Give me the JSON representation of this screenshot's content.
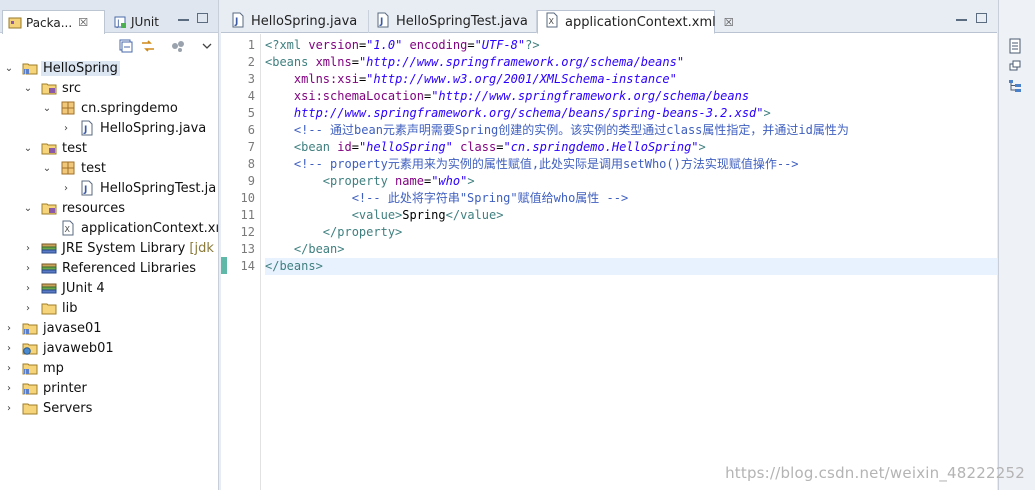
{
  "left_panel": {
    "tabs": [
      {
        "label": "Packa...",
        "close": "☒"
      },
      {
        "label": "JUnit",
        "close": "☒"
      }
    ],
    "tree": [
      {
        "label": "HelloSpring",
        "level": 0,
        "arrow": "⌄",
        "icon": "project-icon",
        "selected": true
      },
      {
        "label": "src",
        "level": 1,
        "arrow": "⌄",
        "icon": "source-folder-icon"
      },
      {
        "label": "cn.springdemo",
        "level": 2,
        "arrow": "⌄",
        "icon": "package-icon"
      },
      {
        "label": "HelloSpring.java",
        "level": 3,
        "arrow": "›",
        "icon": "java-file-icon"
      },
      {
        "label": "test",
        "level": 1,
        "arrow": "⌄",
        "icon": "source-folder-icon"
      },
      {
        "label": "test",
        "level": 2,
        "arrow": "⌄",
        "icon": "package-icon"
      },
      {
        "label": "HelloSpringTest.ja",
        "level": 3,
        "arrow": "›",
        "icon": "java-file-icon"
      },
      {
        "label": "resources",
        "level": 1,
        "arrow": "⌄",
        "icon": "source-folder-icon"
      },
      {
        "label": "applicationContext.xı",
        "level": 2,
        "arrow": "",
        "icon": "xml-file-icon"
      },
      {
        "label": "JRE System Library",
        "suffix": "[jdk",
        "level": 1,
        "arrow": "›",
        "icon": "library-icon"
      },
      {
        "label": "Referenced Libraries",
        "level": 1,
        "arrow": "›",
        "icon": "library-icon"
      },
      {
        "label": "JUnit 4",
        "level": 1,
        "arrow": "›",
        "icon": "library-icon"
      },
      {
        "label": "lib",
        "level": 1,
        "arrow": "›",
        "icon": "folder-icon"
      },
      {
        "label": "javase01",
        "level": 0,
        "arrow": "›",
        "icon": "project-icon"
      },
      {
        "label": "javaweb01",
        "level": 0,
        "arrow": "›",
        "icon": "web-project-icon"
      },
      {
        "label": "mp",
        "level": 0,
        "arrow": "›",
        "icon": "project-icon"
      },
      {
        "label": "printer",
        "level": 0,
        "arrow": "›",
        "icon": "project-icon"
      },
      {
        "label": "Servers",
        "level": 0,
        "arrow": "›",
        "icon": "folder-icon"
      }
    ]
  },
  "editor": {
    "tabs": [
      {
        "label": "HelloSpring.java",
        "icon": "java-file-icon",
        "close": "",
        "active": false
      },
      {
        "label": "HelloSpringTest.java",
        "icon": "java-file-icon",
        "close": "",
        "active": false
      },
      {
        "label": "applicationContext.xml",
        "icon": "xml-file-icon",
        "close": "☒",
        "active": true
      }
    ],
    "current_line": 14,
    "lines": [
      [
        [
          "t",
          "<?xml "
        ],
        [
          "a",
          "version"
        ],
        [
          "k",
          "="
        ],
        [
          "v",
          "\"1.0\""
        ],
        [
          "k",
          " "
        ],
        [
          "a",
          "encoding"
        ],
        [
          "k",
          "="
        ],
        [
          "v",
          "\"UTF-8\""
        ],
        [
          "t",
          "?>"
        ]
      ],
      [
        [
          "t",
          "<beans "
        ],
        [
          "a",
          "xmlns"
        ],
        [
          "k",
          "="
        ],
        [
          "v",
          "\"http://www.springframework.org/schema/beans\""
        ]
      ],
      [
        [
          "k",
          "    "
        ],
        [
          "a",
          "xmlns:xsi"
        ],
        [
          "k",
          "="
        ],
        [
          "v",
          "\"http://www.w3.org/2001/XMLSchema-instance\""
        ]
      ],
      [
        [
          "k",
          "    "
        ],
        [
          "a",
          "xsi:schemaLocation"
        ],
        [
          "k",
          "="
        ],
        [
          "v",
          "\"http://www.springframework.org/schema/beans"
        ]
      ],
      [
        [
          "v",
          "    http://www.springframework.org/schema/beans/spring-beans-3.2.xsd\""
        ],
        [
          "t",
          ">"
        ]
      ],
      [
        [
          "c",
          "    <!-- 通过bean元素声明需要Spring创建的实例。该实例的类型通过class属性指定，并通过id属性为"
        ]
      ],
      [
        [
          "k",
          "    "
        ],
        [
          "t",
          "<bean "
        ],
        [
          "a",
          "id"
        ],
        [
          "k",
          "="
        ],
        [
          "v",
          "\"helloSpring\""
        ],
        [
          "k",
          " "
        ],
        [
          "a",
          "class"
        ],
        [
          "k",
          "="
        ],
        [
          "v",
          "\"cn.springdemo.HelloSpring\""
        ],
        [
          "t",
          ">"
        ]
      ],
      [
        [
          "c",
          "    <!-- property元素用来为实例的属性赋值,此处实际是调用setWho()方法实现赋值操作-->"
        ]
      ],
      [
        [
          "k",
          "        "
        ],
        [
          "t",
          "<property "
        ],
        [
          "a",
          "name"
        ],
        [
          "k",
          "="
        ],
        [
          "v",
          "\"who\""
        ],
        [
          "t",
          ">"
        ]
      ],
      [
        [
          "c",
          "            <!-- 此处将字符串\"Spring\"赋值给who属性 -->"
        ]
      ],
      [
        [
          "k",
          "            "
        ],
        [
          "t",
          "<value>"
        ],
        [
          "x",
          "Spring"
        ],
        [
          "t",
          "</value>"
        ]
      ],
      [
        [
          "k",
          "        "
        ],
        [
          "t",
          "</property>"
        ]
      ],
      [
        [
          "k",
          "    "
        ],
        [
          "t",
          "</bean>"
        ]
      ],
      [
        [
          "t",
          "</beans>"
        ]
      ]
    ]
  },
  "watermark": "https://blog.csdn.net/weixin_48222252",
  "colors": {
    "tag": "#3f7f7f",
    "attribute": "#7f007f",
    "value": "#2a00ff",
    "comment": "#3f5fbf",
    "current_line": "#e8f2fe"
  }
}
